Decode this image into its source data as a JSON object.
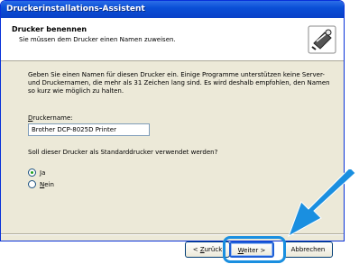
{
  "window": {
    "title": "Druckerinstallations-Assistent"
  },
  "header": {
    "title": "Drucker benennen",
    "subtitle": "Sie müssen dem Drucker einen Namen zuweisen.",
    "icon": "printer-wizard-icon"
  },
  "body": {
    "instructions": "Geben Sie einen Namen für diesen Drucker ein. Einige Programme unterstützen keine Server- und Druckernamen, die mehr als 31 Zeichen lang sind. Es wird deshalb empfohlen, den Namen so kurz wie möglich zu halten.",
    "name_label_mnemonic": "D",
    "name_label_rest": "ruckername:",
    "name_value": "Brother DCP-8025D Printer",
    "default_question": "Soll dieser Drucker als Standarddrucker verwendet werden?",
    "options": [
      {
        "mnemonic": "J",
        "rest": "a",
        "checked": true
      },
      {
        "mnemonic": "N",
        "rest": "ein",
        "checked": false
      }
    ]
  },
  "buttons": {
    "back_prefix": "< ",
    "back_mnemonic": "Z",
    "back_rest": "urück",
    "next_mnemonic": "W",
    "next_rest": "eiter >",
    "cancel": "Abbrechen"
  },
  "colors": {
    "title_bar": "#0a4fd6",
    "highlight": "#1a8fe0",
    "arrow": "#1a8fe0"
  }
}
